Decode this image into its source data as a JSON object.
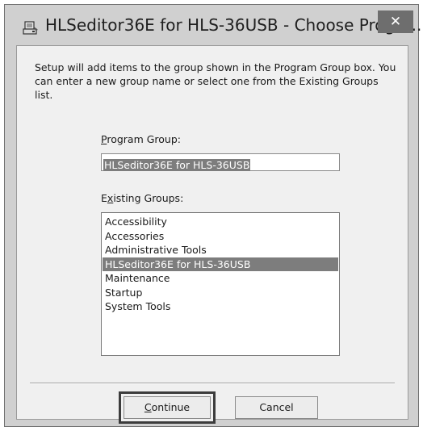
{
  "window": {
    "title": "HLSeditor36E for HLS-36USB - Choose Progra...",
    "close_glyph": "✕",
    "icon": "setup-installer-icon"
  },
  "dialog": {
    "description": "Setup will add items to the group shown in the Program Group box. You can enter a new group name or select one from the Existing Groups list.",
    "program_group": {
      "label_accel": "P",
      "label_rest": "rogram Group:",
      "value": "HLSeditor36E for HLS-36USB"
    },
    "existing_groups": {
      "label_pre": "E",
      "label_accel": "x",
      "label_rest": "isting Groups:",
      "items": [
        "Accessibility",
        "Accessories",
        "Administrative Tools",
        "HLSeditor36E for HLS-36USB",
        "Maintenance",
        "Startup",
        "System Tools"
      ],
      "selected": "HLSeditor36E for HLS-36USB"
    },
    "buttons": {
      "continue_accel": "C",
      "continue_rest": "ontinue",
      "cancel": "Cancel"
    }
  }
}
